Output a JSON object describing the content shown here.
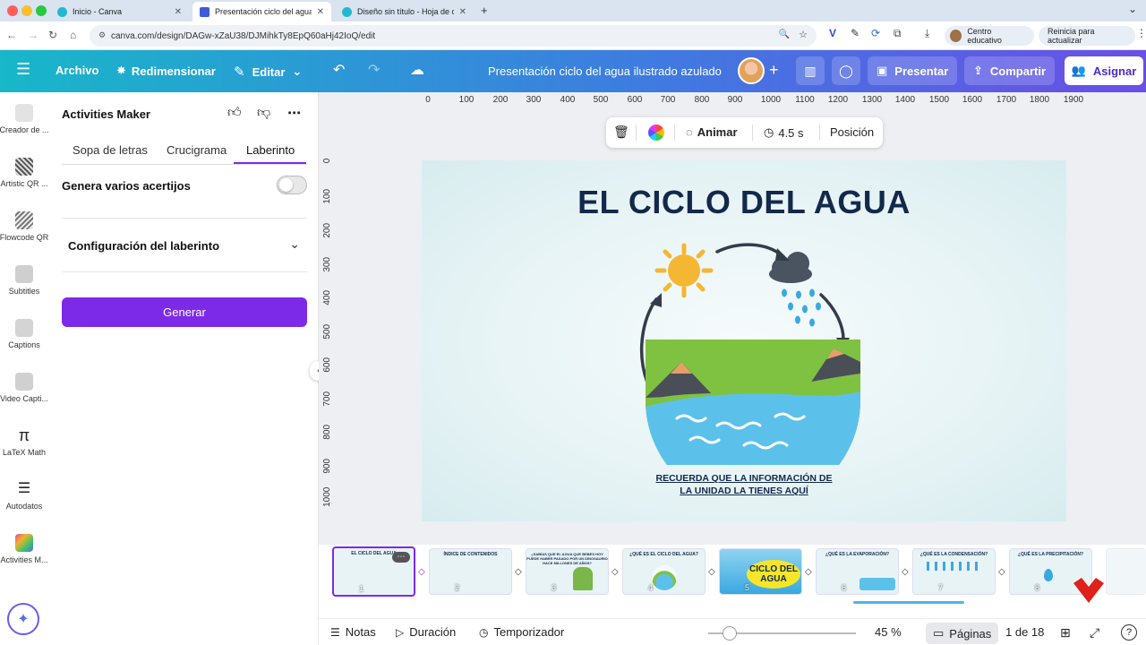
{
  "browser": {
    "tabs": [
      {
        "title": "Inicio - Canva",
        "active": false
      },
      {
        "title": "Presentación ciclo del agua il",
        "active": true
      },
      {
        "title": "Diseño sin título - Hoja de cá",
        "active": false
      }
    ],
    "url": "canva.com/design/DAGw-xZaU38/DJMihkTy8EpQ60aHj42IoQ/edit",
    "profile_label": "Centro educativo",
    "update_label": "Reinicia para actualizar"
  },
  "toolbar": {
    "file_label": "Archivo",
    "resize_label": "Redimensionar",
    "edit_label": "Editar",
    "doc_title": "Presentación ciclo del agua ilustrado azulado",
    "present_label": "Presentar",
    "share_label": "Compartir",
    "assign_label": "Asignar"
  },
  "rail": {
    "items": [
      {
        "label": "Creador de ..."
      },
      {
        "label": "Artistic QR ..."
      },
      {
        "label": "Flowcode QR"
      },
      {
        "label": "Subtitles"
      },
      {
        "label": "Captions"
      },
      {
        "label": "Video Capti..."
      },
      {
        "label": "LaTeX Math"
      },
      {
        "label": "Autodatos"
      },
      {
        "label": "Activities M..."
      }
    ]
  },
  "panel": {
    "title": "Activities Maker",
    "tabs": [
      "Sopa de letras",
      "Crucigrama",
      "Laberinto"
    ],
    "active_tab": "Laberinto",
    "multi_label": "Genera varios acertijos",
    "config_label": "Configuración del laberinto",
    "generate_label": "Generar"
  },
  "ruler": {
    "h": [
      "0",
      "100",
      "200",
      "300",
      "400",
      "500",
      "600",
      "700",
      "800",
      "900",
      "1000",
      "1100",
      "1200",
      "1300",
      "1400",
      "1500",
      "1600",
      "1700",
      "1800",
      "1900"
    ],
    "v": [
      "0",
      "100",
      "200",
      "300",
      "400",
      "500",
      "600",
      "700",
      "800",
      "900",
      "1000"
    ]
  },
  "context_toolbar": {
    "animate_label": "Animar",
    "duration_label": "4.5 s",
    "position_label": "Posición"
  },
  "slide": {
    "title": "EL CICLO DEL AGUA",
    "subtitle_line1": "RECUERDA QUE LA INFORMACIÓN DE",
    "subtitle_line2": "LA UNIDAD LA TIENES AQUÍ"
  },
  "thumbnails": [
    {
      "num": "1",
      "label": "EL CICLO DEL AGUA"
    },
    {
      "num": "2",
      "label": "ÍNDICE DE CONTENIDOS"
    },
    {
      "num": "3",
      "label": "¿SABÍAS QUE EL AGUA QUE BEBES HOY PUEDE HABER PASADO POR UN DINOSAURIO HACE MILLONES DE AÑOS?"
    },
    {
      "num": "4",
      "label": "¿QUÉ ES EL CICLO DEL AGUA?"
    },
    {
      "num": "5",
      "label": "CICLO DEL AGUA"
    },
    {
      "num": "6",
      "label": "¿QUÉ ES LA EVAPORACIÓN?"
    },
    {
      "num": "7",
      "label": "¿QUÉ ES LA CONDENSACIÓN?"
    },
    {
      "num": "8",
      "label": "¿QUÉ ES LA PRECIPITACIÓN?"
    }
  ],
  "bottombar": {
    "notes_label": "Notas",
    "duration_label": "Duración",
    "timer_label": "Temporizador",
    "zoom_label": "45 %",
    "zoom_level_percent": 45,
    "pages_label": "Páginas",
    "page_counter": "1 de 18"
  },
  "colors": {
    "accent": "#7d2ae8",
    "title_navy": "#13294b",
    "topbar_start": "#18b7c9",
    "topbar_end": "#6a4ee6"
  }
}
